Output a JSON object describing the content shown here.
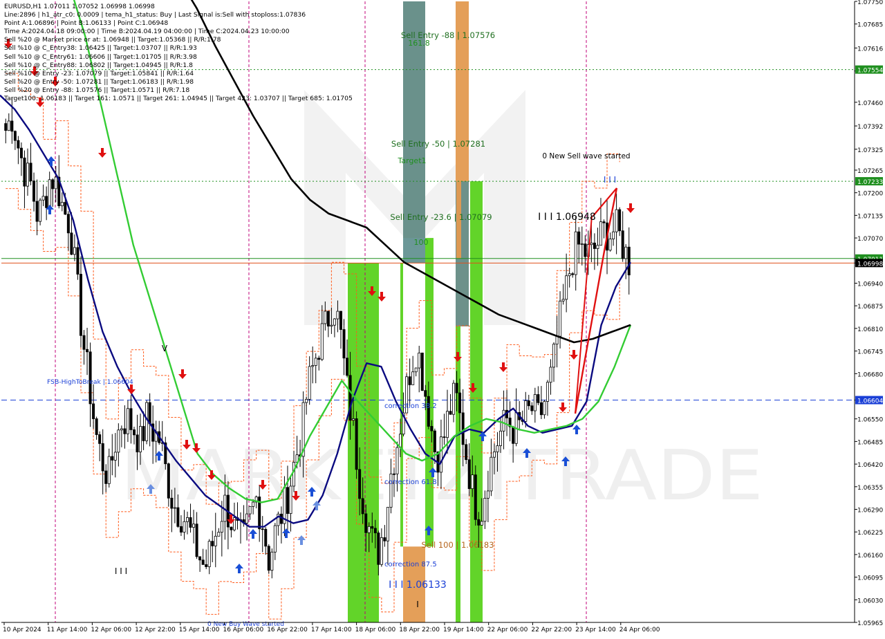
{
  "header": {
    "symbol_line": "EURUSD,H1  1.07011 1.07052 1.06998 1.06998",
    "lines": [
      "Line:2896 | h1_atr_c0: 0.0009 | tema_h1_status: Buy | Last Signal is:Sell with stoploss:1.07836",
      "Point A:1.06896 | Point B:1.06133 | Point C:1.06948",
      "Time A:2024.04.18 09:00:00 | Time B:2024.04.19 04:00:00 | Time C:2024.04.23 10:00:00",
      "Sell %20 @ Market price or at: 1.06948 || Target:1.05368 || R/R:1.78",
      "Sell %10 @ C_Entry38: 1.06425 || Target:1.03707 || R/R:1.93",
      "Sell %10 @ C_Entry61: 1.06606 || Target:1.01705 || R/R:3.98",
      "Sell %10 @ C_Entry88: 1.06802 || Target:1.04945 || R/R:1.8",
      "Sell %10 @ Entry -23: 1.07079 || Target:1.05841 || R/R:1.64",
      "Sell %20 @ Entry -50: 1.07281 || Target:1.06183 || R/R:1.98",
      "Sell %20 @ Entry -88: 1.07576 || Target:1.0571 || R/R:7.18",
      "Target100: 1.06183 || Target 161: 1.0571 || Target 261: 1.04945 || Target 423: 1.03707 || Target 685: 1.01705"
    ]
  },
  "watermark": "MARKETZITRADE",
  "colors": {
    "up_candle": "#000000",
    "down_candle": "#000000",
    "ema_fast": "#0a0a80",
    "ema_mid": "#33cc33",
    "ema_slow": "#000000",
    "zone_green": "#5ad21e",
    "zone_orange": "#e39a50",
    "zone_teal": "#5f8f8f",
    "buy_arrow": "#1a4fd6",
    "sell_arrow": "#e01010",
    "envelope": "#ff5a1a",
    "magenta_vline": "#c0007a"
  },
  "chart_data": {
    "type": "candlestick",
    "symbol": "EURUSD",
    "timeframe": "H1",
    "ylim": [
      1.05965,
      1.0775
    ],
    "y_ticks": [
      1.0775,
      1.07685,
      1.07616,
      1.0755,
      1.0746,
      1.07392,
      1.07325,
      1.07265,
      1.072,
      1.07135,
      1.0707,
      1.07011,
      1.06998,
      1.0694,
      1.06875,
      1.0681,
      1.06745,
      1.0668,
      1.06604,
      1.0655,
      1.06485,
      1.0642,
      1.06355,
      1.0629,
      1.06225,
      1.0616,
      1.06095,
      1.0603,
      1.05965
    ],
    "highlighted_price_labels": [
      {
        "value": "1.07554",
        "color": "#1f8f1f"
      },
      {
        "value": "1.07233",
        "color": "#1f8f1f"
      },
      {
        "value": "1.07011",
        "color": "#1f8f1f"
      },
      {
        "value": "1.06998",
        "color": "#000000"
      },
      {
        "value": "1.06604",
        "color": "#1a3fd6"
      }
    ],
    "x_labels": [
      "10 Apr 2024",
      "11 Apr 14:00",
      "12 Apr 06:00",
      "12 Apr 22:00",
      "15 Apr 14:00",
      "16 Apr 06:00",
      "16 Apr 22:00",
      "17 Apr 14:00",
      "18 Apr 06:00",
      "18 Apr 22:00",
      "19 Apr 14:00",
      "22 Apr 06:00",
      "22 Apr 22:00",
      "23 Apr 14:00",
      "24 Apr 06:00"
    ],
    "close_path": [
      1.0738,
      1.0742,
      1.0733,
      1.0726,
      1.0722,
      1.0713,
      1.0718,
      1.0725,
      1.0722,
      1.0715,
      1.0711,
      1.0695,
      1.0678,
      1.0665,
      1.0651,
      1.0643,
      1.0638,
      1.0648,
      1.0654,
      1.0655,
      1.0652,
      1.0648,
      1.0656,
      1.0651,
      1.0649,
      1.0639,
      1.0631,
      1.0628,
      1.0626,
      1.0621,
      1.0616,
      1.0612,
      1.0618,
      1.0624,
      1.0631,
      1.0626,
      1.0622,
      1.062,
      1.0627,
      1.0632,
      1.0625,
      1.0614,
      1.0623,
      1.0628,
      1.0634,
      1.0643,
      1.065,
      1.0664,
      1.0671,
      1.0678,
      1.0683,
      1.0689,
      1.0681,
      1.0665,
      1.0653,
      1.0638,
      1.0628,
      1.062,
      1.0617,
      1.0625,
      1.064,
      1.0649,
      1.066,
      1.067,
      1.0676,
      1.0666,
      1.0655,
      1.0644,
      1.0648,
      1.0657,
      1.0662,
      1.0652,
      1.0641,
      1.0631,
      1.0628,
      1.0639,
      1.0646,
      1.0651,
      1.0655,
      1.0652,
      1.0653,
      1.0656,
      1.0658,
      1.0655,
      1.0661,
      1.0668,
      1.0681,
      1.069,
      1.07,
      1.0705,
      1.0703,
      1.0702,
      1.0705,
      1.0709,
      1.0708,
      1.071,
      1.0705,
      1.07
    ],
    "lines": [
      {
        "name": "",
        "color": "#0a0a80",
        "values": [
          1.0748,
          1.0744,
          1.0738,
          1.0731,
          1.0724,
          1.0712,
          1.0695,
          1.068,
          1.067,
          1.0662,
          1.0655,
          1.0649,
          1.0643,
          1.0638,
          1.0633,
          1.063,
          1.0627,
          1.0624,
          1.0624,
          1.0627,
          1.0625,
          1.0626,
          1.0633,
          1.0645,
          1.066,
          1.0671,
          1.067,
          1.066,
          1.0652,
          1.0645,
          1.0642,
          1.065,
          1.0652,
          1.0651,
          1.0655,
          1.0658,
          1.0653,
          1.0651,
          1.0652,
          1.0653,
          1.066,
          1.0682,
          1.0693,
          1.07
        ]
      },
      {
        "name": "",
        "color": "#33cc33",
        "values": [
          1.078,
          1.0765,
          1.0745,
          1.0725,
          1.0705,
          1.069,
          1.0675,
          1.066,
          1.0645,
          1.0639,
          1.0635,
          1.0632,
          1.0631,
          1.0632,
          1.064,
          1.065,
          1.0658,
          1.0666,
          1.066,
          1.0655,
          1.065,
          1.0645,
          1.0643,
          1.0645,
          1.065,
          1.0653,
          1.0655,
          1.0654,
          1.0652,
          1.0651,
          1.0652,
          1.0653,
          1.0655,
          1.066,
          1.067,
          1.0682
        ]
      },
      {
        "name": "",
        "color": "#000000",
        "values": [
          1.079,
          1.0782,
          1.0773,
          1.0762,
          1.0752,
          1.0742,
          1.0733,
          1.0724,
          1.0718,
          1.0714,
          1.0712,
          1.071,
          1.0705,
          1.07,
          1.0697,
          1.0694,
          1.0691,
          1.0688,
          1.0685,
          1.0683,
          1.0681,
          1.0679,
          1.0677,
          1.0678,
          1.068,
          1.0682
        ]
      }
    ],
    "horizontal_levels": [
      {
        "value": 1.07554,
        "style": "dotted",
        "color": "#1f8f1f"
      },
      {
        "value": 1.07233,
        "style": "dotted",
        "color": "#1f8f1f"
      },
      {
        "value": 1.07011,
        "style": "solid",
        "color": "#1f8f1f"
      },
      {
        "value": 1.06998,
        "style": "solid",
        "color": "#e0501a"
      },
      {
        "value": 1.06604,
        "style": "dashed",
        "color": "#1a3fd6"
      }
    ],
    "annotations": [
      {
        "text": "Sell Entry -88 | 1.07576",
        "color": "#1f6f1f"
      },
      {
        "text": "161.8",
        "color": "#1f8f1f"
      },
      {
        "text": "Sell Entry -50 | 1.07281",
        "color": "#1f6f1f"
      },
      {
        "text": "Target1",
        "color": "#1f8f1f"
      },
      {
        "text": "0 New Sell wave started",
        "color": "#000000"
      },
      {
        "text": "Sell Entry -23.6 | 1.07079",
        "color": "#1f6f1f"
      },
      {
        "text": "100",
        "color": "#1f8f1f"
      },
      {
        "text": "I I I  1.06948",
        "color": "#000000"
      },
      {
        "text": "I I I",
        "color": "#1a3fd6"
      },
      {
        "text": "FSB-HighToBreak | 1.06604",
        "color": "#1a3fd6"
      },
      {
        "text": "correction 38.2",
        "color": "#1a3fd6"
      },
      {
        "text": "correction 61.8",
        "color": "#1a3fd6"
      },
      {
        "text": "Sell 100 | 1.06183",
        "color": "#b5651d"
      },
      {
        "text": "correction 87.5",
        "color": "#1a3fd6"
      },
      {
        "text": "I I I  1.06133",
        "color": "#1a3fd6"
      },
      {
        "text": "V",
        "color": "#000000"
      },
      {
        "text": "I I I",
        "color": "#000000"
      },
      {
        "text": "I",
        "color": "#000000"
      },
      {
        "text": "0 New Buy Wave started",
        "color": "#1a3fd6"
      }
    ],
    "buy_arrow_count": 16,
    "sell_arrow_count": 18
  }
}
